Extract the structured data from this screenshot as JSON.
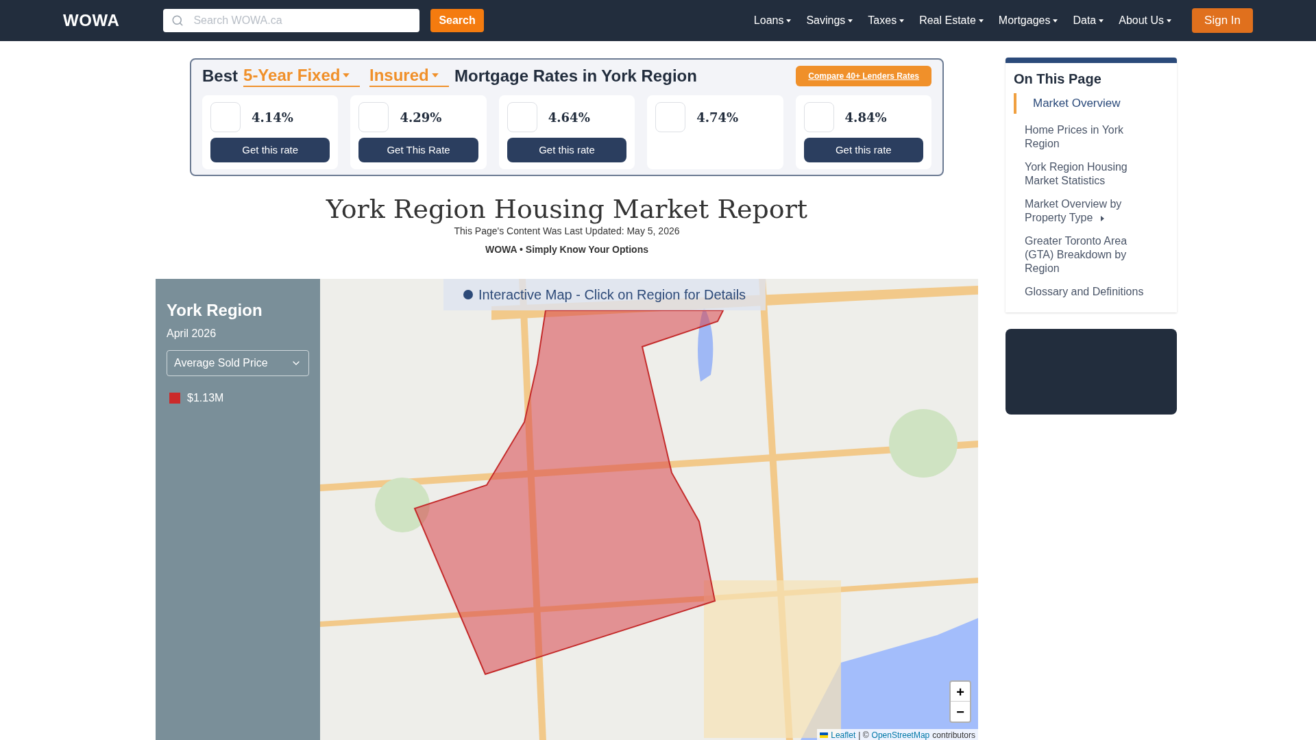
{
  "nav": {
    "logo": "WOWA",
    "search": {
      "placeholder": "Search WOWA.ca",
      "button": "Search"
    },
    "menu": [
      {
        "label": "Loans"
      },
      {
        "label": "Savings"
      },
      {
        "label": "Taxes"
      },
      {
        "label": "Real Estate"
      },
      {
        "label": "Mortgages"
      },
      {
        "label": "Data"
      },
      {
        "label": "About Us"
      }
    ],
    "sign_in": "Sign In"
  },
  "rates": {
    "prefix": "Best",
    "term": "5-Year Fixed",
    "insurance": "Insured",
    "title": "Mortgage Rates in York Region",
    "compare": "Compare 40+ Lenders Rates",
    "cards": [
      {
        "rate": "4.14%",
        "button": "Get this rate"
      },
      {
        "rate": "4.29%",
        "button": "Get This Rate"
      },
      {
        "rate": "4.64%",
        "button": "Get this rate"
      },
      {
        "rate": "4.74%"
      },
      {
        "rate": "4.84%",
        "button": "Get this rate"
      }
    ]
  },
  "report": {
    "title": "York Region Housing Market Report",
    "updated": "This Page's Content Was Last Updated: May 5, 2026",
    "tagline": "WOWA • Simply Know Your Options"
  },
  "map": {
    "region": "York Region",
    "period": "April 2026",
    "metric": "Average Sold Price",
    "legend": [
      {
        "color": "#cc2a2a",
        "label": "$1.13M"
      }
    ],
    "banner": "Interactive Map - Click on Region for Details",
    "zoom_in": "+",
    "zoom_out": "−",
    "attribution": {
      "leaflet": "Leaflet",
      "separator": "| ©",
      "osm": "OpenStreetMap",
      "suffix": "contributors"
    }
  },
  "toc": {
    "title": "On This Page",
    "items": [
      {
        "label": "Market Overview",
        "selected": true,
        "has_submenu": false
      },
      {
        "label": "Home Prices in York Region",
        "selected": false,
        "has_submenu": false
      },
      {
        "label": "York Region Housing Market Statistics",
        "selected": false,
        "has_submenu": false
      },
      {
        "label": "Market Overview by Property Type",
        "selected": false,
        "has_submenu": true
      },
      {
        "label": "Greater Toronto Area (GTA) Breakdown by Region",
        "selected": false,
        "has_submenu": false
      },
      {
        "label": "Glossary and Definitions",
        "selected": false,
        "has_submenu": false
      }
    ]
  }
}
